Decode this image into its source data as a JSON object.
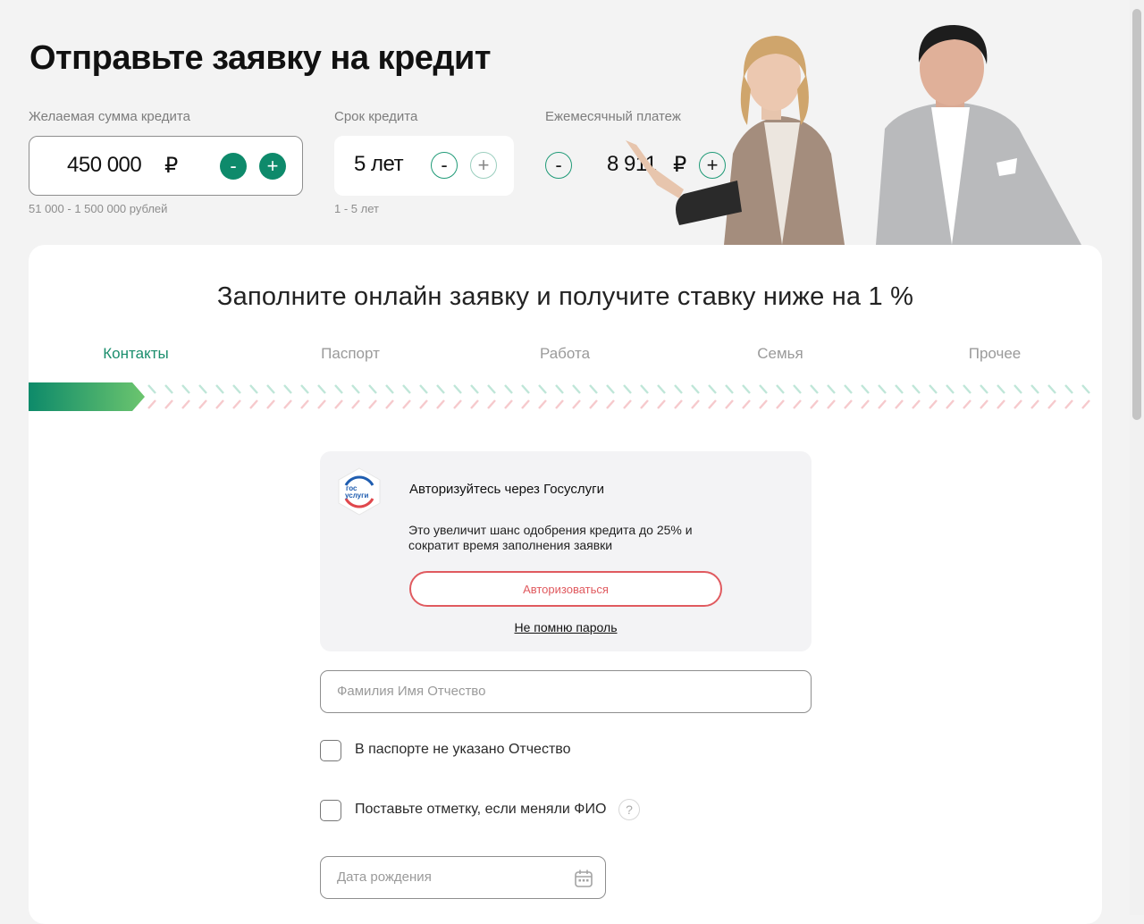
{
  "header": {
    "title": "Отправьте заявку на кредит"
  },
  "calculator": {
    "amount": {
      "label": "Желаемая сумма кредита",
      "value": "450 000",
      "currency": "₽",
      "minus": "-",
      "plus": "+",
      "hint": "51 000 - 1 500 000 рублей"
    },
    "term": {
      "label": "Срок кредита",
      "value": "5 лет",
      "minus": "-",
      "plus": "+",
      "hint": "1 - 5 лет"
    },
    "payment": {
      "label": "Ежемесячный платеж",
      "value": "8 911",
      "currency": "₽",
      "minus": "-",
      "plus": "+"
    }
  },
  "form": {
    "title": "Заполните онлайн заявку и получите ставку ниже на 1 %",
    "steps": [
      {
        "label": "Контакты"
      },
      {
        "label": "Паспорт"
      },
      {
        "label": "Работа"
      },
      {
        "label": "Семья"
      },
      {
        "label": "Прочее"
      }
    ],
    "gosuslugi": {
      "logo_text_top": "гос",
      "logo_text_bottom": "услуги",
      "title": "Авторизуйтесь через Госуслуги",
      "text": "Это увеличит шанс одобрения кредита до 25% и сократит время заполнения заявки",
      "button": "Авторизоваться",
      "link": "Не помню пароль"
    },
    "full_name": {
      "placeholder": "Фамилия Имя Отчество"
    },
    "no_patronymic": {
      "label": "В паспорте не указано Отчество"
    },
    "name_changed": {
      "label": "Поставьте отметку, если меняли ФИО",
      "help": "?"
    },
    "birth_date": {
      "placeholder": "Дата рождения"
    }
  },
  "colors": {
    "accent": "#0e8a6b",
    "gosuslugi_red": "#e05a5f",
    "background": "#f3f3f3"
  }
}
